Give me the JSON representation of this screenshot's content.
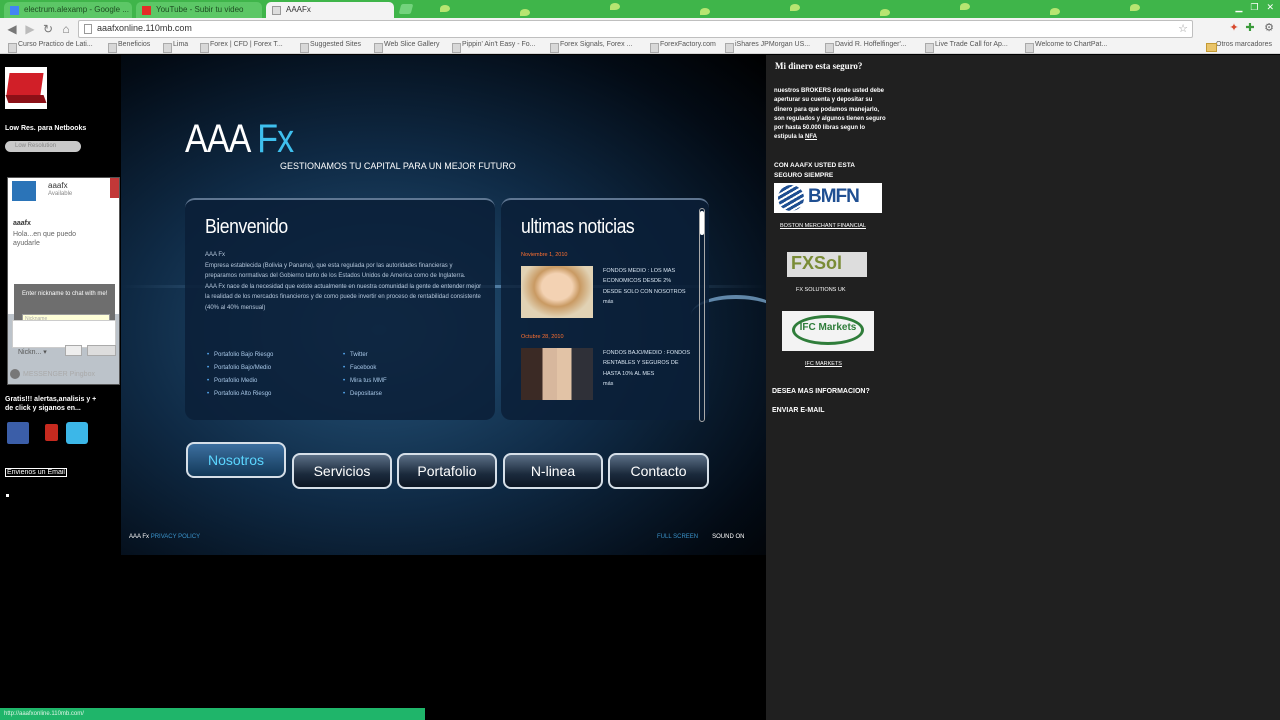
{
  "browser": {
    "tabs": [
      {
        "label": "electrum.alexamp - Google ..."
      },
      {
        "label": "YouTube - Subir tu video"
      },
      {
        "label": "AAAFx"
      }
    ],
    "url": "aaafxonline.110mb.com",
    "bookmarks": [
      "Curso Practico de Lati...",
      "Beneficios",
      "Lima",
      "Forex | CFD | Forex T...",
      "Suggested Sites",
      "Web Slice Gallery",
      "Pippin' Ain't Easy - Fo...",
      "Forex Signals, Forex ...",
      "ForexFactory.com",
      "iShares JPMorgan US...",
      "David R. Hoffelfinger'...",
      "Live Trade Call for Ap...",
      "Welcome to ChartPat...",
      "Otros marcadores"
    ]
  },
  "left": {
    "lowres_title": "Low Res. para Netbooks",
    "lowres_button": "Low Resolution",
    "messenger": {
      "name": "aaafx",
      "status": "Available",
      "sender": "aaafx",
      "greeting": "Hola...en que puedo ayudarle",
      "nick_prompt": "Enter nickname to chat with me!",
      "nick_placeholder": "Nickname",
      "nick_dropdown": "Nickn... ▾",
      "pingbox": "MESSENGER Pingbox"
    },
    "alerts": "Gratis!!! alertas,analisis y + de click y siganos en...",
    "email_link": "Envienos un Email"
  },
  "site": {
    "logo_main": "AAA",
    "logo_fx": "Fx",
    "tagline": "GESTIONAMOS TU CAPITAL PARA UN MEJOR FUTURO",
    "welcome_title": "Bienvenido",
    "welcome_text_1": "AAA Fx",
    "welcome_text_2": "Empresa establecida (Bolivia y Panama), que esta regulada por las autoridades financieras y preparamos normativas del Gobierno tanto de los Estados Unidos de America como de Inglaterra.",
    "welcome_text_3": "AAA Fx nace de la necesidad que existe actualmente en nuestra comunidad la gente de entender mejor la realidad de los mercados financieros y de como puede invertir en proceso de rentabilidad consistente (40% al 40% mensual)",
    "links": [
      "Portafolio Bajo Riesgo",
      "Portafolio Bajo/Medio",
      "Portafolio Medio",
      "Portafolio Alto Riesgo",
      "Twitter",
      "Facebook",
      "Mira tus MMF",
      "Depositarse"
    ],
    "news_title": "ultimas noticias",
    "news": [
      {
        "date": "Noviembre 1, 2010",
        "text": "FONDOS MEDIO : LOS MAS ECONOMICOS DESDE 2% DESDE SOLO CON NOSOTROS",
        "more": "más"
      },
      {
        "date": "Octubre 28, 2010",
        "text": "FONDOS BAJO/MEDIO : FONDOS RENTABLES Y SEGUROS DE HASTA 10% AL MES",
        "more": "más"
      }
    ],
    "nav": [
      "Nosotros",
      "Servicios",
      "Portafolio",
      "N-linea",
      "Contacto"
    ],
    "footer_left_a": "AAA Fx",
    "footer_left_b": "PRIVACY POLICY",
    "footer_right_a": "FULL SCREEN",
    "footer_right_b": "SOUND ON"
  },
  "right": {
    "title": "Mi dinero esta seguro?",
    "text": "nuestros BROKERS donde usted debe aperturar su cuenta y depositar su dinero para que podamos manejarlo, son regulados y algunos tienen seguro por hasta 50.000 libras segun lo estipula la",
    "nfa": "NFA",
    "secure": "CON AAAFX USTED ESTA SEGURO SIEMPRE",
    "bmfn_logo": "BMFN",
    "bmfn_caption": "BOSTON MERCHANT FINANCIAL",
    "fxsol_logo": "FXSol",
    "fxsol_caption": "FX SOLUTIONS UK",
    "ifc_logo": "IFC Markets",
    "ifc_caption": "IFC MARKETS",
    "info": "DESEA MAS INFORMACION?",
    "email": "ENVIAR E-MAIL"
  },
  "status_url": "http://aaafxonline.110mb.com/",
  "colors": {
    "accent": "#3fc0ee",
    "tabbar": "#3fb54a",
    "statusbar": "#1fb56a"
  }
}
